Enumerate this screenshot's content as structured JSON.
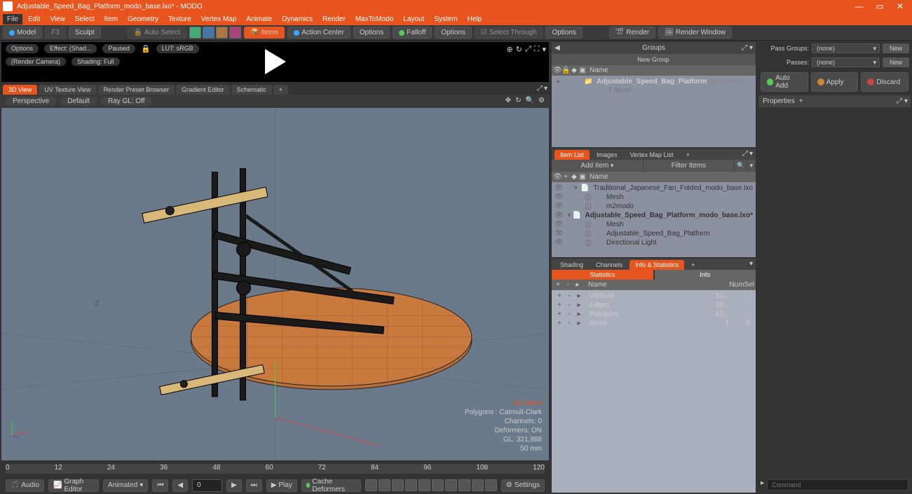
{
  "titlebar": {
    "title": "Adjustable_Speed_Bag_Platform_modo_base.lxo* - MODO"
  },
  "menubar": [
    "File",
    "Edit",
    "View",
    "Select",
    "Item",
    "Geometry",
    "Texture",
    "Vertex Map",
    "Animate",
    "Dynamics",
    "Render",
    "MaxToModo",
    "Layout",
    "System",
    "Help"
  ],
  "toolbar": {
    "model": "Model",
    "f3": "F3",
    "sculpt": "Sculpt",
    "autoselect": "Auto Select",
    "items": "Items",
    "actioncenter": "Action Center",
    "options": "Options",
    "falloff": "Falloff",
    "selectthrough": "Select Through",
    "render": "Render",
    "renderwindow": "Render Window"
  },
  "preview": {
    "options": "Options",
    "effect": "Effect: (Shad...",
    "paused": "Paused",
    "lut": "LUT: sRGB",
    "camera": "(Render Camera)",
    "shading": "Shading: Full"
  },
  "viewtabs": [
    "3D View",
    "UV Texture View",
    "Render Preset Browser",
    "Gradient Editor",
    "Schematic"
  ],
  "subbar": {
    "perspective": "Perspective",
    "default": "Default",
    "raygl": "Ray GL: Off"
  },
  "vpinfo": {
    "noitems": "No Items",
    "poly": "Polygons : Catmull-Clark",
    "channels": "Channels: 0",
    "deformers": "Deformers: ON",
    "gl": "GL: 321,888",
    "mm": "50 mm"
  },
  "timeline": {
    "marks": [
      "0",
      "12",
      "24",
      "36",
      "48",
      "60",
      "72",
      "84",
      "96",
      "108",
      "120"
    ]
  },
  "playbar": {
    "audio": "Audio",
    "graph": "Graph Editor",
    "animated": "Animated",
    "frame": "0",
    "play": "Play",
    "cache": "Cache Deformers",
    "settings": "Settings"
  },
  "groups": {
    "title": "Groups",
    "newgroup": "New Group",
    "name": "Name",
    "item": "Adjustable_Speed_Bag_Platform",
    "count": "(4)",
    "type": ": Group",
    "sub": "7 Items"
  },
  "itemtabs": [
    "Item List",
    "Images",
    "Vertex Map List"
  ],
  "additem": "Add Item",
  "filteritems": "Filter Items",
  "items": [
    {
      "name": "Traditional_Japanese_Fan_Folded_modo_base.lxo",
      "bold": false,
      "indent": 0
    },
    {
      "name": "Mesh",
      "bold": false,
      "indent": 1
    },
    {
      "name": "m2modo",
      "bold": false,
      "indent": 1
    },
    {
      "name": "Adjustable_Speed_Bag_Platform_modo_base.lxo*",
      "bold": true,
      "indent": 0
    },
    {
      "name": "Mesh",
      "bold": false,
      "indent": 1
    },
    {
      "name": "Adjustable_Speed_Bag_Platform",
      "bold": false,
      "indent": 1,
      "count": "(2)"
    },
    {
      "name": "Directional Light",
      "bold": false,
      "indent": 1
    }
  ],
  "infotabs": [
    "Shading",
    "Channels",
    "Info & Statistics"
  ],
  "stattabs": {
    "stats": "Statistics",
    "info": "Info"
  },
  "stathead": {
    "name": "Name",
    "num": "Num",
    "sel": "Sel"
  },
  "stats": [
    {
      "name": "Vertices",
      "num": "10...",
      "sel": "..."
    },
    {
      "name": "Edges",
      "num": "20...",
      "sel": "..."
    },
    {
      "name": "Polygons",
      "num": "10...",
      "sel": "..."
    },
    {
      "name": "Items",
      "num": "1",
      "sel": "0"
    }
  ],
  "passes": {
    "passgroups": "Pass Groups:",
    "none": "(none)",
    "new": "New",
    "passes_l": "Passes:"
  },
  "actions": {
    "autoadd": "Auto Add",
    "apply": "Apply",
    "discard": "Discard"
  },
  "props": {
    "title": "Properties"
  },
  "cmd": {
    "label": "Command"
  }
}
